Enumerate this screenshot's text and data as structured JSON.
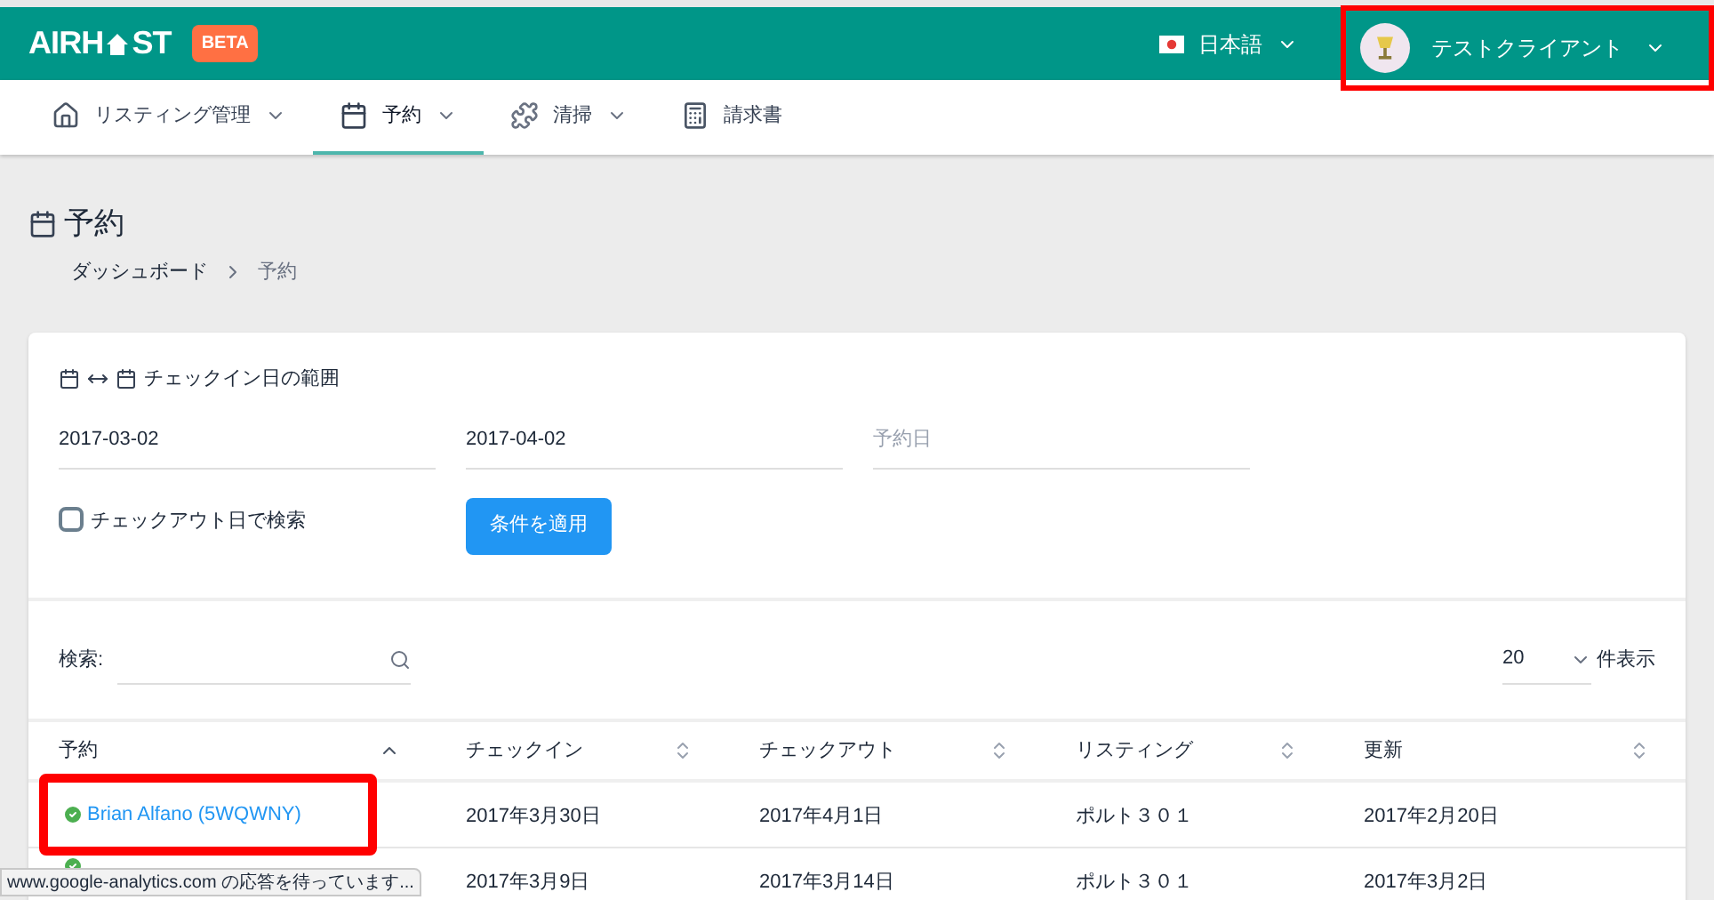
{
  "header": {
    "logo": "AIRH",
    "logo_rest": "ST",
    "badge": "BETA",
    "language": "日本語",
    "user": {
      "name": "テストクライアント",
      "annotated": true
    }
  },
  "nav": [
    {
      "label": "リスティング管理",
      "dropdown": true,
      "selected": false
    },
    {
      "label": "予約",
      "dropdown": true,
      "selected": true
    },
    {
      "label": "清掃",
      "dropdown": true,
      "selected": false
    },
    {
      "label": "請求書",
      "dropdown": false,
      "selected": false
    }
  ],
  "page": {
    "title": "予約",
    "breadcrumb": [
      {
        "label": "ダッシュボード",
        "current": false
      },
      {
        "label": "予約",
        "current": true
      }
    ]
  },
  "filter": {
    "label": "チェックイン日の範囲",
    "start": "2017-03-02",
    "end": "2017-04-02",
    "booking_date": {
      "placeholder": "予約日"
    },
    "checkout": {
      "label": "チェックアウト日で検索",
      "checked": false
    },
    "apply": "条件を適用"
  },
  "search": {
    "label": "検索:",
    "page_size": "20",
    "page_size_label": "件表示"
  },
  "table": {
    "columns": [
      {
        "label": "予約",
        "sorted": true
      },
      {
        "label": "チェックイン",
        "sorted": false
      },
      {
        "label": "チェックアウト",
        "sorted": false
      },
      {
        "label": "リスティング",
        "sorted": false
      },
      {
        "label": "更新",
        "sorted": false
      }
    ],
    "rows": [
      {
        "booking": "Brian Alfano (5WQWNY)",
        "confirmed": true,
        "annotated": true,
        "checkin": "2017年3月30日",
        "checkout": "2017年4月1日",
        "listing": "ポルト３０１",
        "updated": "2017年2月20日"
      },
      {
        "confirmed": true,
        "annotated": false,
        "checkin": "2017年3月9日",
        "checkout": "2017年3月14日",
        "listing": "ポルト３０１",
        "updated": "2017年3月2日"
      }
    ]
  },
  "status_bar": "www.google-analytics.com の応答を待っています..."
}
